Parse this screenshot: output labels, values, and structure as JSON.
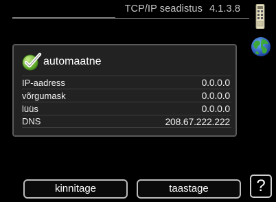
{
  "header": {
    "title": "TCP/IP seadistus",
    "menu_number": "4.1.3.8"
  },
  "icons": {
    "device": "thermostat-device-icon",
    "globe": "globe-icon",
    "check": "checkmark-icon",
    "help": "help-icon"
  },
  "panel": {
    "automatic_label": "automaatne",
    "automatic_checked": true,
    "rows": [
      {
        "label": "IP-aadress",
        "value": "0.0.0.0"
      },
      {
        "label": "võrgumask",
        "value": "0.0.0.0"
      },
      {
        "label": "lüüs",
        "value": "0.0.0.0"
      },
      {
        "label": "DNS",
        "value": "208.67.222.222"
      }
    ]
  },
  "buttons": {
    "confirm_label": "kinnitage",
    "reset_label": "taastage",
    "help_label": "?"
  },
  "colors": {
    "background": "#000000",
    "panel": "#222222",
    "check_green": "#7ac143",
    "globe_blue": "#2b6cc4",
    "globe_green": "#3aa33a"
  }
}
